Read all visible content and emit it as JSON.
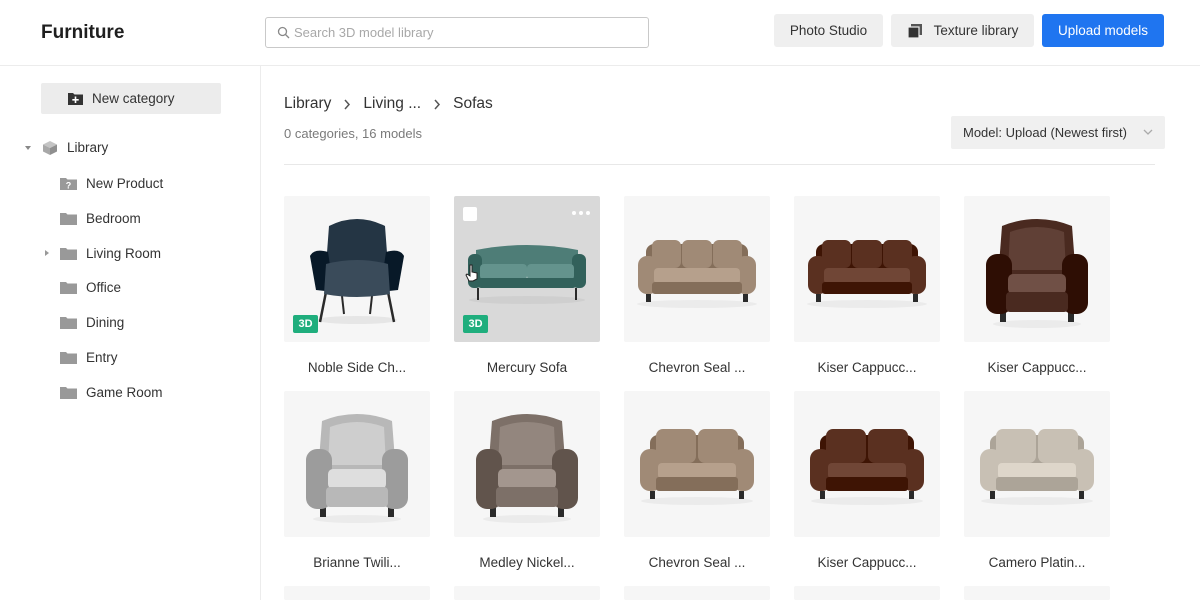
{
  "header": {
    "title": "Furniture",
    "search_placeholder": "Search 3D model library",
    "photo_studio_label": "Photo Studio",
    "texture_library_label": "Texture library",
    "upload_label": "Upload models"
  },
  "sidebar": {
    "new_category_label": "New category",
    "root": {
      "label": "Library",
      "expanded": true
    },
    "items": [
      {
        "label": "New Product",
        "icon": "question-folder-icon",
        "has_children": false
      },
      {
        "label": "Bedroom",
        "icon": "folder-icon",
        "has_children": false
      },
      {
        "label": "Living Room",
        "icon": "folder-icon",
        "has_children": true
      },
      {
        "label": "Office",
        "icon": "folder-icon",
        "has_children": false
      },
      {
        "label": "Dining",
        "icon": "folder-icon",
        "has_children": false
      },
      {
        "label": "Entry",
        "icon": "folder-icon",
        "has_children": false
      },
      {
        "label": "Game Room",
        "icon": "folder-icon",
        "has_children": false
      }
    ]
  },
  "main": {
    "breadcrumb": [
      "Library",
      "Living ...",
      "Sofas"
    ],
    "summary": "0 categories, 16 models",
    "sort_label": "Model: Upload (Newest first)",
    "models": [
      {
        "name": "Noble Side Ch...",
        "badge": "3D",
        "kind": "armchair-dark",
        "color": "#243544"
      },
      {
        "name": "Mercury Sofa",
        "badge": "3D",
        "kind": "sofa-slim",
        "color": "#4e7d77",
        "selected": true
      },
      {
        "name": "Chevron Seal ...",
        "badge": "",
        "kind": "sofa3",
        "color": "#a08a76"
      },
      {
        "name": "Kiser Cappucc...",
        "badge": "",
        "kind": "sofa3",
        "color": "#5a3020"
      },
      {
        "name": "Kiser Cappucc...",
        "badge": "",
        "kind": "armchair",
        "color": "#4a2a20"
      },
      {
        "name": "Brianne Twili...",
        "badge": "",
        "kind": "armchair",
        "color": "#b8b8b8"
      },
      {
        "name": "Medley Nickel...",
        "badge": "",
        "kind": "armchair",
        "color": "#7d7068"
      },
      {
        "name": "Chevron Seal ...",
        "badge": "",
        "kind": "loveseat",
        "color": "#a08a76"
      },
      {
        "name": "Kiser Cappucc...",
        "badge": "",
        "kind": "loveseat",
        "color": "#5a3020"
      },
      {
        "name": "Camero Platin...",
        "badge": "",
        "kind": "loveseat",
        "color": "#c8c0b4"
      }
    ]
  },
  "colors": {
    "accent": "#1f75f0",
    "badge_3d": "#1fae7d",
    "button_gray": "#efefef"
  }
}
